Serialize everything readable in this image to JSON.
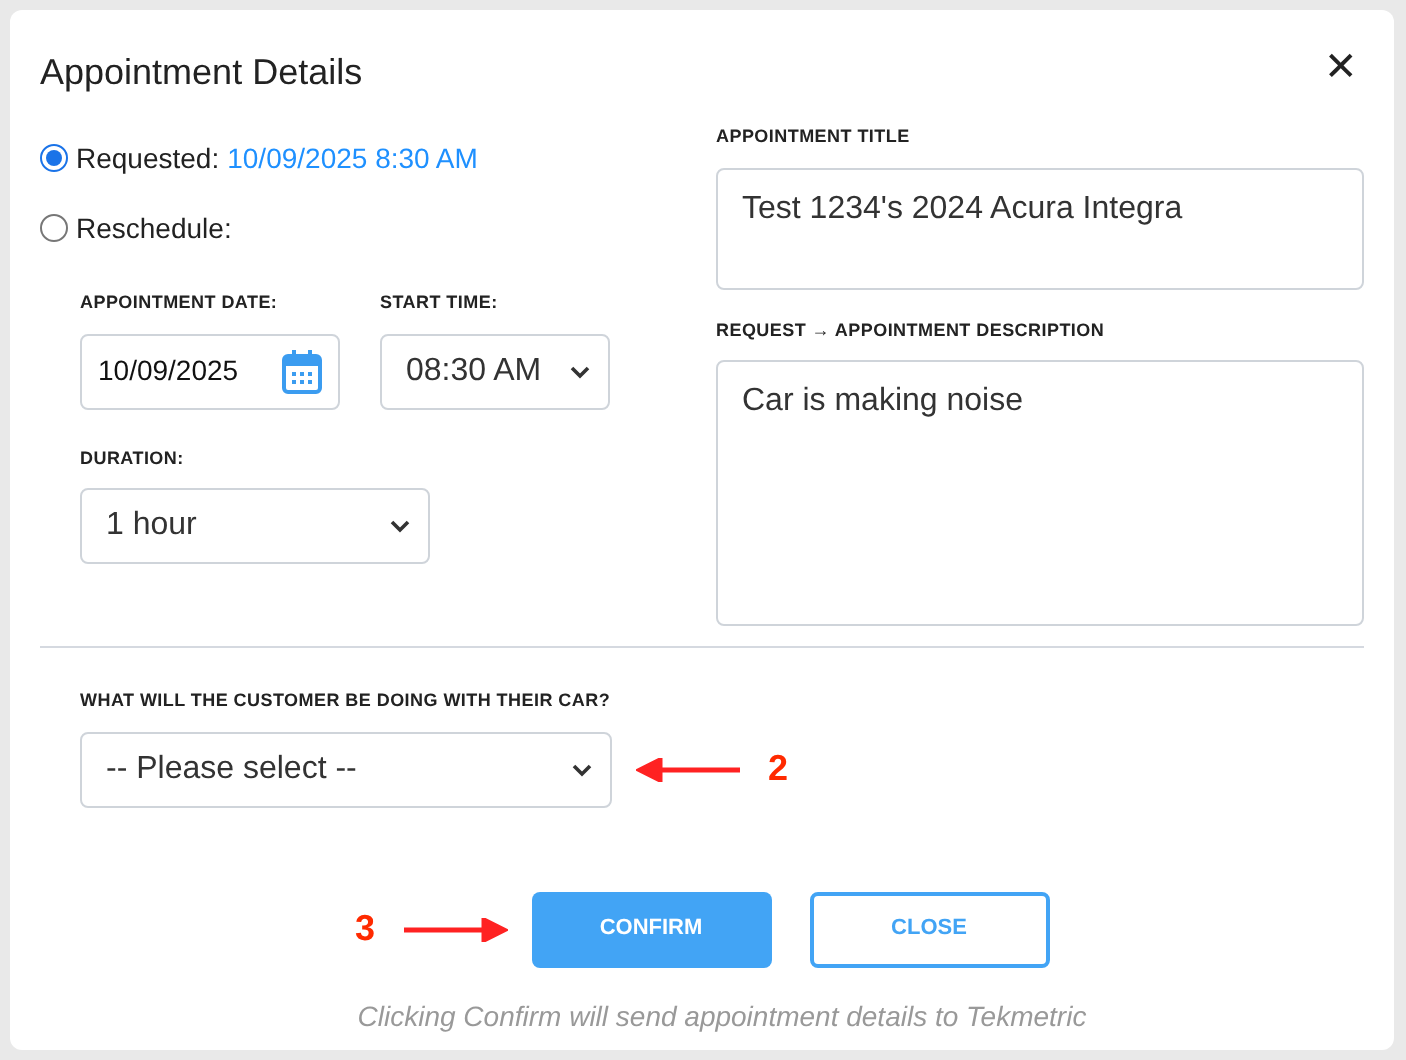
{
  "dialog": {
    "title": "Appointment Details",
    "close_icon": "✕"
  },
  "options": [
    {
      "label": "Requested:",
      "value": "10/09/2025 8:30 AM",
      "selected": true
    },
    {
      "label": "Reschedule:",
      "selected": false
    }
  ],
  "appointment_date": {
    "label": "APPOINTMENT DATE:",
    "value": "10/09/2025"
  },
  "start_time": {
    "label": "START TIME:",
    "value": "08:30 AM"
  },
  "duration": {
    "label": "DURATION:",
    "value": "1 hour"
  },
  "appointment_title": {
    "label": "APPOINTMENT TITLE",
    "value": "Test 1234's 2024 Acura Integra"
  },
  "description": {
    "label": "REQUEST → APPOINTMENT DESCRIPTION",
    "value": "Car is making noise"
  },
  "customer_activity": {
    "label": "WHAT WILL THE CUSTOMER BE DOING WITH THEIR CAR?",
    "value": "-- Please select --",
    "annotation": "2"
  },
  "buttons": [
    {
      "label": "CONFIRM",
      "kind": "primary",
      "annotation": "3"
    },
    {
      "label": "CLOSE",
      "kind": "secondary"
    }
  ],
  "footer_note": "Clicking Confirm will send appointment details to Tekmetric"
}
